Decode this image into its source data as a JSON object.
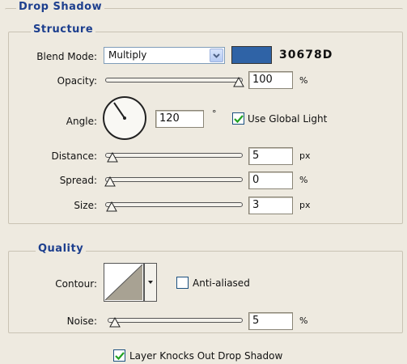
{
  "drop_shadow": {
    "title": "Drop Shadow",
    "structure": {
      "title": "Structure",
      "blend_mode_label": "Blend Mode:",
      "blend_mode_value": "Multiply",
      "color_hex": "30678D",
      "color_swatch": "#2f63a6",
      "opacity_label": "Opacity:",
      "opacity_value": "100",
      "opacity_unit": "%",
      "opacity_level": 1.0,
      "angle_label": "Angle:",
      "angle_value": "120",
      "angle_unit": "°",
      "use_global_light_label": "Use Global Light",
      "use_global_light_checked": true,
      "distance_label": "Distance:",
      "distance_value": "5",
      "distance_unit": "px",
      "distance_level": 0.02,
      "spread_label": "Spread:",
      "spread_value": "0",
      "spread_unit": "%",
      "spread_level": 0.0,
      "size_label": "Size:",
      "size_value": "3",
      "size_unit": "px",
      "size_level": 0.01
    },
    "quality": {
      "title": "Quality",
      "contour_label": "Contour:",
      "anti_aliased_label": "Anti-aliased",
      "anti_aliased_checked": false,
      "noise_label": "Noise:",
      "noise_value": "5",
      "noise_unit": "%",
      "noise_level": 0.05
    },
    "layer_knocks_out_label": "Layer Knocks Out Drop Shadow",
    "layer_knocks_out_checked": true
  },
  "icons": {
    "dropdown": "chevron-down-icon",
    "checkmark": "checkmark-icon",
    "slider": "triangle-slider-thumb-icon"
  }
}
